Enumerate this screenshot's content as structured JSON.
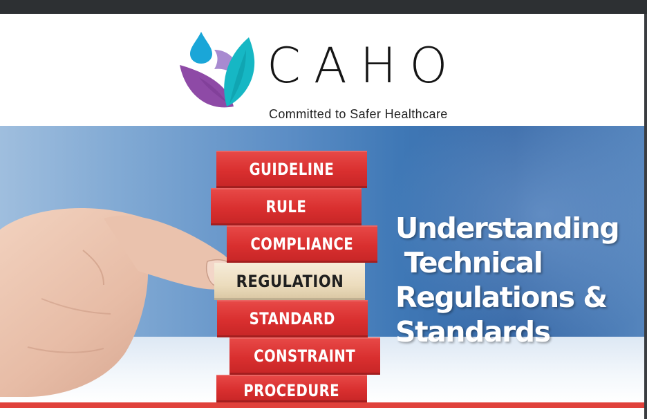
{
  "brand": {
    "name": "CAHO",
    "tagline": "Committed to Safer Healthcare",
    "colors": {
      "purple": "#8e4aa6",
      "teal": "#16b7c4",
      "drop": "#1aa6d8"
    }
  },
  "banner": {
    "blocks": [
      {
        "label": "GUIDELINE"
      },
      {
        "label": "RULE"
      },
      {
        "label": "COMPLIANCE"
      },
      {
        "label": "REGULATION"
      },
      {
        "label": "STANDARD"
      },
      {
        "label": "CONSTRAINT"
      },
      {
        "label": "PROCEDURE"
      }
    ],
    "title_lines": [
      "Understanding",
      " Technical",
      "Regulations &",
      "Standards"
    ],
    "accent": "#e0413b"
  }
}
